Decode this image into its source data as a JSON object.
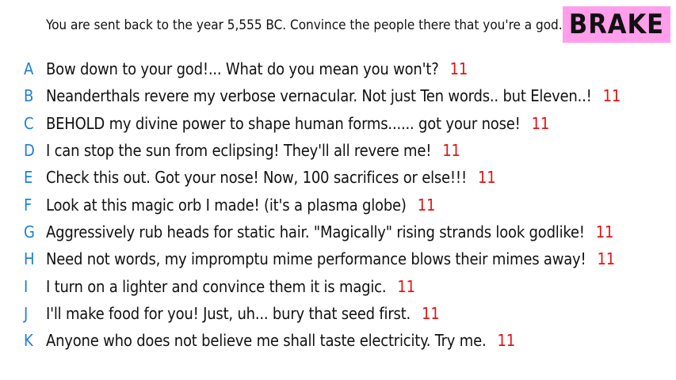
{
  "prompt": "You are sent back to the year 5,555 BC. Convince the people there that you're a god.",
  "button": {
    "label": "BRAKE"
  },
  "answers": [
    {
      "letter": "A",
      "text": "Bow down to your god!... What do you mean you won't?",
      "score": "11"
    },
    {
      "letter": "B",
      "text": "Neanderthals revere my verbose vernacular. Not just Ten words.. but Eleven..!",
      "score": "11"
    },
    {
      "letter": "C",
      "text": "BEHOLD my divine power to shape human forms...... got your nose!",
      "score": "11"
    },
    {
      "letter": "D",
      "text": "I can stop the sun from eclipsing! They'll all revere me!",
      "score": "11"
    },
    {
      "letter": "E",
      "text": "Check this out. Got your nose! Now, 100 sacrifices or else!!!",
      "score": "11"
    },
    {
      "letter": "F",
      "text": "Look at this magic orb I made! (it's a plasma globe)",
      "score": "11"
    },
    {
      "letter": "G",
      "text": "Aggressively rub heads for static hair. \"Magically\" rising strands look godlike!",
      "score": "11"
    },
    {
      "letter": "H",
      "text": "Need not words, my impromptu mime performance blows their mimes away!",
      "score": "11"
    },
    {
      "letter": "I",
      "text": "I turn on a lighter and convince them it is magic.",
      "score": "11"
    },
    {
      "letter": "J",
      "text": "I'll make food for you! Just, uh... bury that seed first.",
      "score": "11"
    },
    {
      "letter": "K",
      "text": "Anyone who does not believe me shall taste electricity. Try me.",
      "score": "11"
    }
  ],
  "colors": {
    "letter": "#1e7fd8",
    "score": "#e01515",
    "button_bg": "#ff9eea"
  }
}
